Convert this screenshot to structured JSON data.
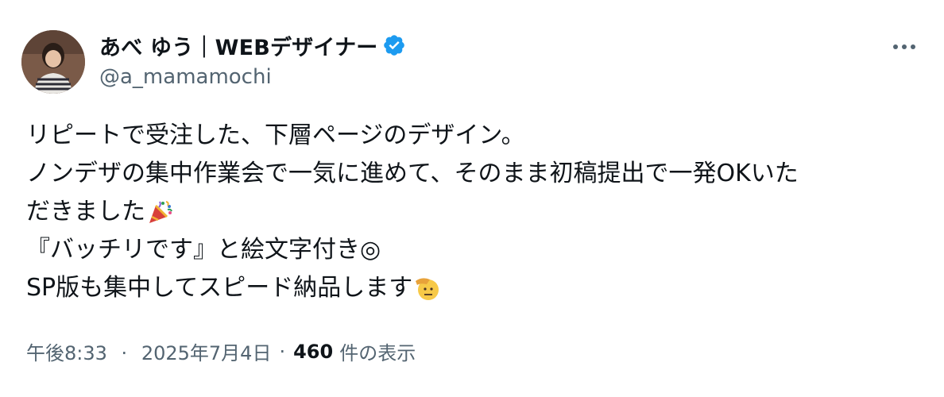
{
  "author": {
    "display_name": "あべ ゆう｜WEBデザイナー",
    "handle": "@a_mamamochi",
    "verified_icon": "verified-badge-icon",
    "verified_color": "#1d9bf0"
  },
  "more_menu": {
    "icon": "more-horizontal-icon"
  },
  "tweet": {
    "line1": "リピートで受注した、下層ページのデザイン。",
    "line2": "ノンデザの集中作業会で一気に進めて、そのまま初稿提出で一発OKいた",
    "line3": "だきました",
    "line3_emoji": "party-popper-emoji",
    "line4": "『バッチリです』と絵文字付き◎",
    "line5": "SP版も集中してスピード納品します",
    "line5_emoji": "saluting-face-emoji"
  },
  "meta": {
    "time": "午後8:33",
    "separator": "·",
    "date": "2025年7月4日",
    "view_count": "460",
    "view_label": "件の表示"
  },
  "colors": {
    "text": "#0f1419",
    "secondary_text": "#536471",
    "accent": "#1d9bf0"
  }
}
